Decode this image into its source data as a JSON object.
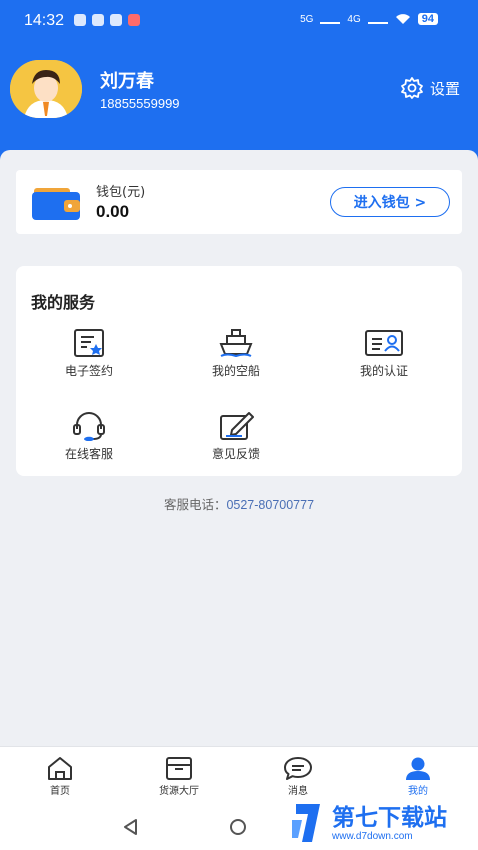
{
  "status_bar": {
    "time": "14:32",
    "network": "5G",
    "network2": "4G",
    "battery": "94"
  },
  "profile": {
    "name": "刘万春",
    "phone": "18855559999",
    "settings_label": "设置"
  },
  "wallet": {
    "label": "钱包(元)",
    "amount": "0.00",
    "button_label": "进入钱包 >"
  },
  "services": {
    "title": "我的服务",
    "items": [
      {
        "label": "电子签约",
        "icon": "contract-icon"
      },
      {
        "label": "我的空船",
        "icon": "ship-icon"
      },
      {
        "label": "我的认证",
        "icon": "id-card-icon"
      },
      {
        "label": "在线客服",
        "icon": "headset-icon"
      },
      {
        "label": "意见反馈",
        "icon": "feedback-icon"
      }
    ]
  },
  "hotline": {
    "label": "客服电话：",
    "number": "0527-80700777"
  },
  "tabs": [
    {
      "label": "首页",
      "icon": "home-icon"
    },
    {
      "label": "货源大厅",
      "icon": "box-icon"
    },
    {
      "label": "消息",
      "icon": "message-icon"
    },
    {
      "label": "我的",
      "icon": "user-icon",
      "active": true
    }
  ],
  "watermark": {
    "title": "第七下载站",
    "url": "www.d7down.com"
  },
  "colors": {
    "brand_blue": "#1e6ff0",
    "background": "#eef0f4"
  }
}
